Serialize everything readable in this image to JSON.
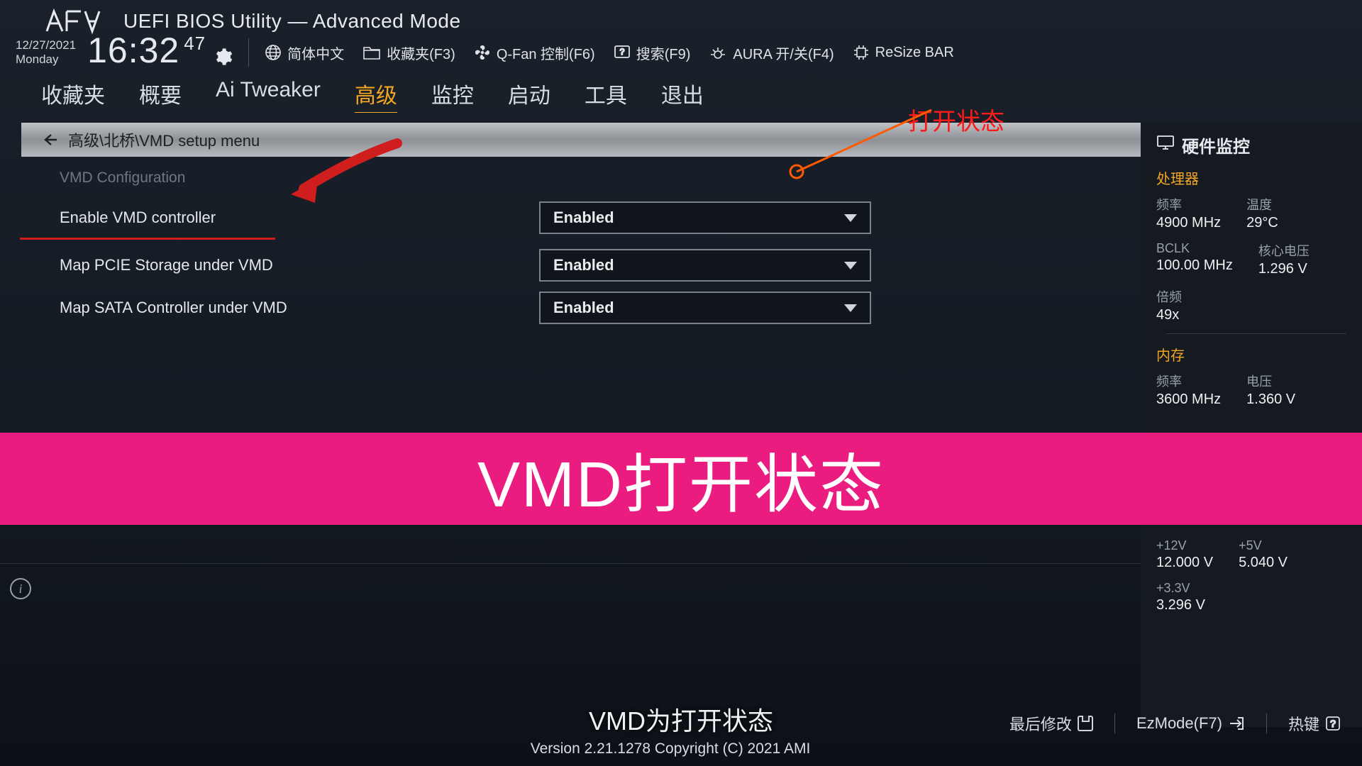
{
  "header": {
    "title": "UEFI BIOS Utility — Advanced Mode",
    "date": "12/27/2021",
    "day": "Monday",
    "time": "16:32",
    "seconds": "47"
  },
  "toolbar": {
    "language": "简体中文",
    "favorites": "收藏夹(F3)",
    "qfan": "Q-Fan 控制(F6)",
    "search": "搜索(F9)",
    "aura": "AURA 开/关(F4)",
    "resize": "ReSize BAR"
  },
  "tabs": [
    "收藏夹",
    "概要",
    "Ai Tweaker",
    "高级",
    "监控",
    "启动",
    "工具",
    "退出"
  ],
  "activeTab": 3,
  "breadcrumb": "高级\\北桥\\VMD setup menu",
  "section": "VMD Configuration",
  "settings": [
    {
      "label": "Enable VMD controller",
      "value": "Enabled"
    },
    {
      "label": "Map PCIE Storage under VMD",
      "value": "Enabled"
    },
    {
      "label": "Map SATA Controller under VMD",
      "value": "Enabled"
    }
  ],
  "sidebar": {
    "title": "硬件监控",
    "cpu": {
      "heading": "处理器",
      "freq_k": "频率",
      "freq_v": "4900 MHz",
      "temp_k": "温度",
      "temp_v": "29°C",
      "bclk_k": "BCLK",
      "bclk_v": "100.00 MHz",
      "vcore_k": "核心电压",
      "vcore_v": "1.296 V",
      "ratio_k": "倍频",
      "ratio_v": "49x"
    },
    "mem": {
      "heading": "内存",
      "freq_k": "频率",
      "freq_v": "3600 MHz",
      "volt_k": "电压",
      "volt_v": "1.360 V"
    },
    "volt": {
      "p12_k": "+12V",
      "p12_v": "12.000 V",
      "p5_k": "+5V",
      "p5_v": "5.040 V",
      "p33_k": "+3.3V",
      "p33_v": "3.296 V"
    }
  },
  "annot": {
    "open_status": "打开状态",
    "banner": "VMD打开状态",
    "subtitle": "VMD为打开状态"
  },
  "footer": {
    "last_mod": "最后修改",
    "ezmode": "EzMode(F7)",
    "hotkey": "热键",
    "version": "Version 2.21.1278 Copyright (C) 2021 AMI"
  }
}
